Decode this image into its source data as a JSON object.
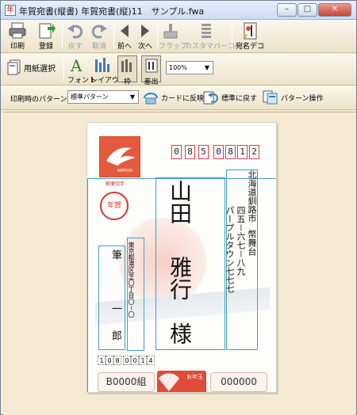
{
  "window": {
    "title": "年賀宛書(縦書) 年賀宛書(縦)11　サンプル.fwa",
    "app_icon": "document-icon",
    "min": "–",
    "max": "□",
    "close": "✕"
  },
  "toolbar": {
    "print": "印刷",
    "register": "登録",
    "undo": "戻す",
    "cancel": "取消",
    "prev": "前へ",
    "next": "次へ",
    "flap": "フラップ",
    "custom_barcode": "カスタマバーコード",
    "address_deco": "宛名デコ"
  },
  "toolbar2": {
    "paper_select": "用紙選択",
    "font": "フォント",
    "layout": "レイアウト",
    "frame": "枠",
    "placement": "差出",
    "zoom": "100%"
  },
  "toolbar3": {
    "pattern_label": "印刷時のパターン",
    "pattern_value": "標準パターン",
    "apply_card": "カードに反映",
    "reset_std": "標準に戻す",
    "pattern_ops": "パターン操作"
  },
  "card": {
    "stamp_caption": "郵便切手",
    "nenga": "年賀",
    "stamp_brand": "NIPPON",
    "zip_digits": [
      "0",
      "8",
      "5",
      "0",
      "8",
      "1",
      "2"
    ],
    "recipient_address_1": "北海道釧路市",
    "recipient_address_2": "幣舞台",
    "recipient_address_3": "四五－六七－八九",
    "recipient_address_4": "パープルタウン七七七",
    "recipient_name_family": "山田",
    "recipient_name_given": "雅行",
    "recipient_honorific": "様",
    "sender_address": "東京都港区芝〇丁目〇－〇",
    "sender_name_1": "筆",
    "sender_name_2": "一",
    "sender_name_3": "郎",
    "sender_zip_digits": [
      "1",
      "0",
      "8",
      "0",
      "0",
      "1",
      "4"
    ],
    "lottery_left": "B0000組",
    "lottery_right": "000000",
    "otoshidama": "お年玉"
  }
}
